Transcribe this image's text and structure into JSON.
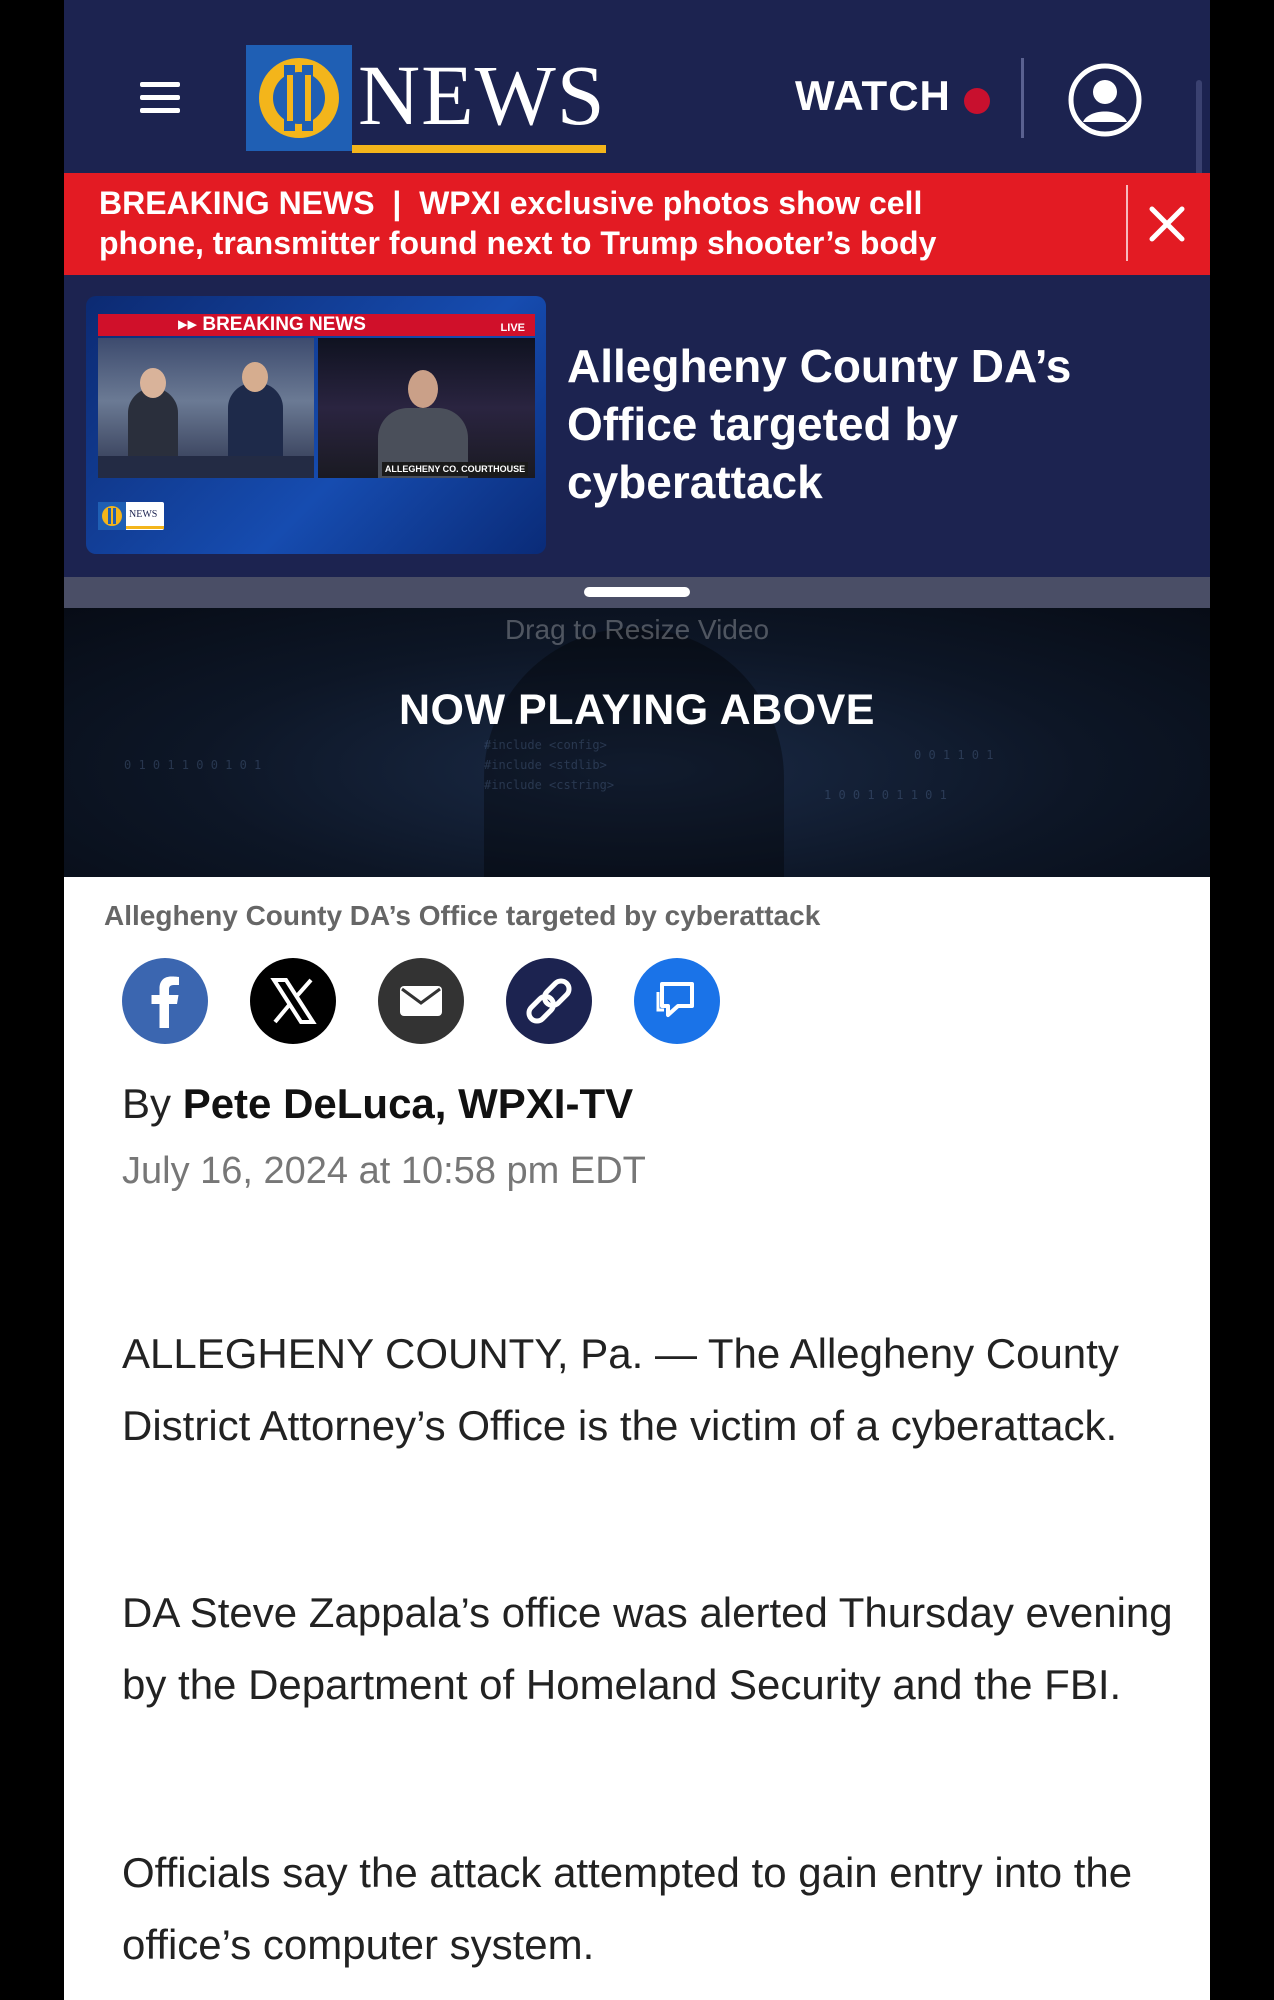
{
  "header": {
    "logo_text": "NEWS",
    "watch_label": "WATCH",
    "colors": {
      "header_bg": "#1c2350",
      "accent_red": "#c8102e",
      "logo_gold": "#f3b51b",
      "logo_blue": "#1f5fb4"
    }
  },
  "breaking": {
    "label": "BREAKING NEWS",
    "separator": "|",
    "headline": "WPXI exclusive photos show cell phone, transmitter found next to Trump shooter’s body",
    "bg_color": "#e31b23"
  },
  "video": {
    "thumbnail": {
      "banner": "BREAKING NEWS",
      "live_tag": "LIVE",
      "caption": "ALLEGHENY CO. COURTHOUSE",
      "logo_text": "NEWS"
    },
    "title": "Allegheny County DA’s Office targeted by cyberattack",
    "drag_hint": "Drag to Resize Video",
    "now_playing": "NOW PLAYING ABOVE"
  },
  "article": {
    "caption": "Allegheny County DA’s Office targeted by cyberattack",
    "share_icons": [
      "facebook-icon",
      "x-icon",
      "email-icon",
      "link-icon",
      "comment-icon"
    ],
    "byline_prefix": "By",
    "author": "Pete DeLuca, WPXI-TV",
    "date": "July 16, 2024 at 10:58 pm EDT",
    "paragraphs": [
      "ALLEGHENY COUNTY, Pa. — The Allegheny County District Attorney’s Office is the victim of a cyberattack.",
      "DA Steve Zappala’s office was alerted Thursday evening by the Department of Homeland Security and the FBI.",
      "Officials say the attack attempted to gain entry into the office’s computer system."
    ]
  }
}
